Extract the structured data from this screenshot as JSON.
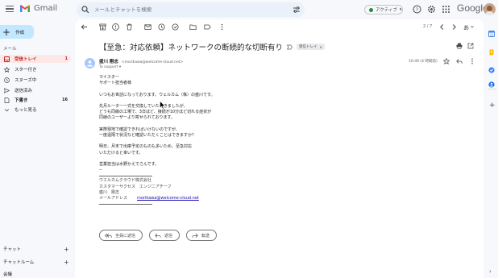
{
  "header": {
    "app_name": "Gmail",
    "search_placeholder": "メールとチャットを検索",
    "status_label": "アクティブ",
    "google_word": "Google"
  },
  "sidebar": {
    "compose_label": "作成",
    "mail_section_label": "メール",
    "items": [
      {
        "label": "受信トレイ",
        "count": "1",
        "icon": "inbox-icon"
      },
      {
        "label": "スター付き",
        "count": "",
        "icon": "star-icon"
      },
      {
        "label": "スヌーズ中",
        "count": "",
        "icon": "clock-icon"
      },
      {
        "label": "送信済み",
        "count": "",
        "icon": "send-icon"
      },
      {
        "label": "下書き",
        "count": "16",
        "icon": "draft-icon"
      },
      {
        "label": "もっと見る",
        "count": "",
        "icon": "chevron-down-icon"
      }
    ],
    "chat_label": "チャット",
    "chatroom_label": "チャットルーム",
    "meet_label": "会議"
  },
  "toolbar": {
    "pager": "2 / 7"
  },
  "email": {
    "subject": "【至急：対応依頼】ネットワークの断続的な切断有り",
    "label_chip": "受信トレイ",
    "sender_name": "盛川 剛志",
    "sender_email": "<morikawa@welcome-cloud.net>",
    "to_line": "To support ▾",
    "time": "16:49 (4 時間前)",
    "body": {
      "l1": "マイスター",
      "l2": "サポート担当者様",
      "l3": "いつもお世話になっております。ウェルカム（株）の盛川です。",
      "l4": "先月ルーター一式を交換していただきましたが、",
      "l5": "どうも同線の工場で、3日ほど、接続が10分ほど切れる症状が",
      "l6": "同線のユーザーより寄せられております。",
      "l7": "実際現地で確認できればいけないのですが、",
      "l8": "一度遠隔で状況など確認いただくことはできますか？",
      "l9": "明日、月末で出庫予定のものも多いため、至急対応",
      "l10": "いただけると幸いです。",
      "l11": "営業担当は水野かえでさんです。",
      "l12": "--",
      "sig1": "ウエルカムクラウド株式会社",
      "sig2": "カスタマーサクセス　エンジニアチーフ",
      "sig3": "盛川　剛志",
      "sig4_label": "メールアドレス",
      "sig4_link": "morikawa@welcome-cloud.net"
    },
    "reply_all_label": "全員に返信",
    "reply_label": "返信",
    "forward_label": "転送"
  }
}
